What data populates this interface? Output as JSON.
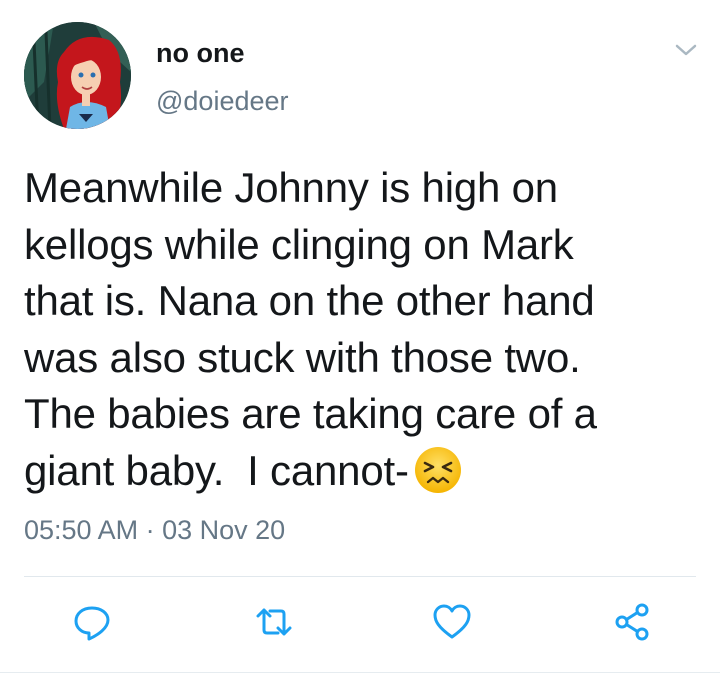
{
  "tweet": {
    "display_name": "no one",
    "handle": "@doiedeer",
    "lines": [
      "Meanwhile Johnny is high on",
      "kellogs while clinging on Mark",
      "that is. Nana on the other hand",
      "was also stuck with those two.",
      "The babies are taking care of a",
      "giant baby.  I cannot-"
    ],
    "emoji": "persevering-face",
    "timestamp": "05:50 AM · 03 Nov 20"
  },
  "actions": [
    {
      "icon": "reply-icon"
    },
    {
      "icon": "retweet-icon"
    },
    {
      "icon": "like-icon"
    },
    {
      "icon": "share-icon"
    }
  ],
  "colors": {
    "text": "#14171a",
    "secondary": "#657786",
    "icon": "#1da1f2",
    "divider": "#e1e8ed"
  }
}
